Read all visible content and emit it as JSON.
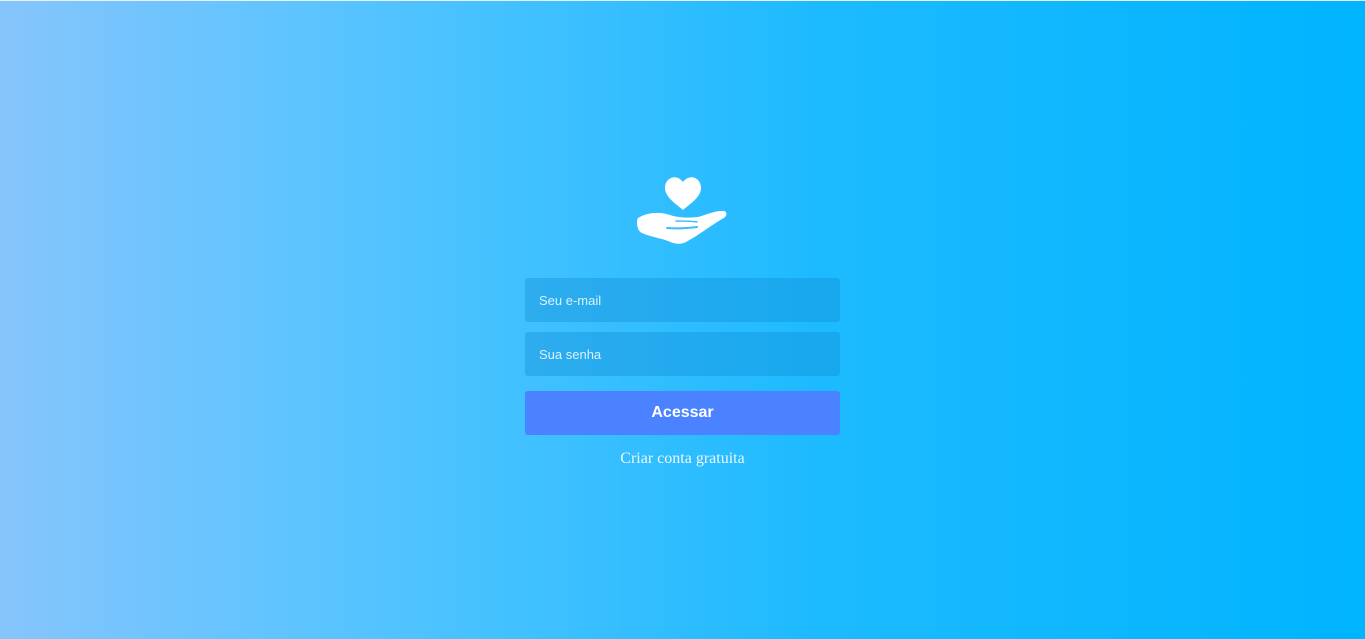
{
  "logo": {
    "icon": "hand-holding-heart-icon",
    "color": "#ffffff"
  },
  "form": {
    "email_placeholder": "Seu e-mail",
    "password_placeholder": "Sua senha",
    "submit_label": "Acessar",
    "signup_link": "Criar conta gratuita"
  },
  "colors": {
    "background_start": "#86c5fc",
    "background_end": "#00b4ff",
    "button": "#4a82ff"
  }
}
